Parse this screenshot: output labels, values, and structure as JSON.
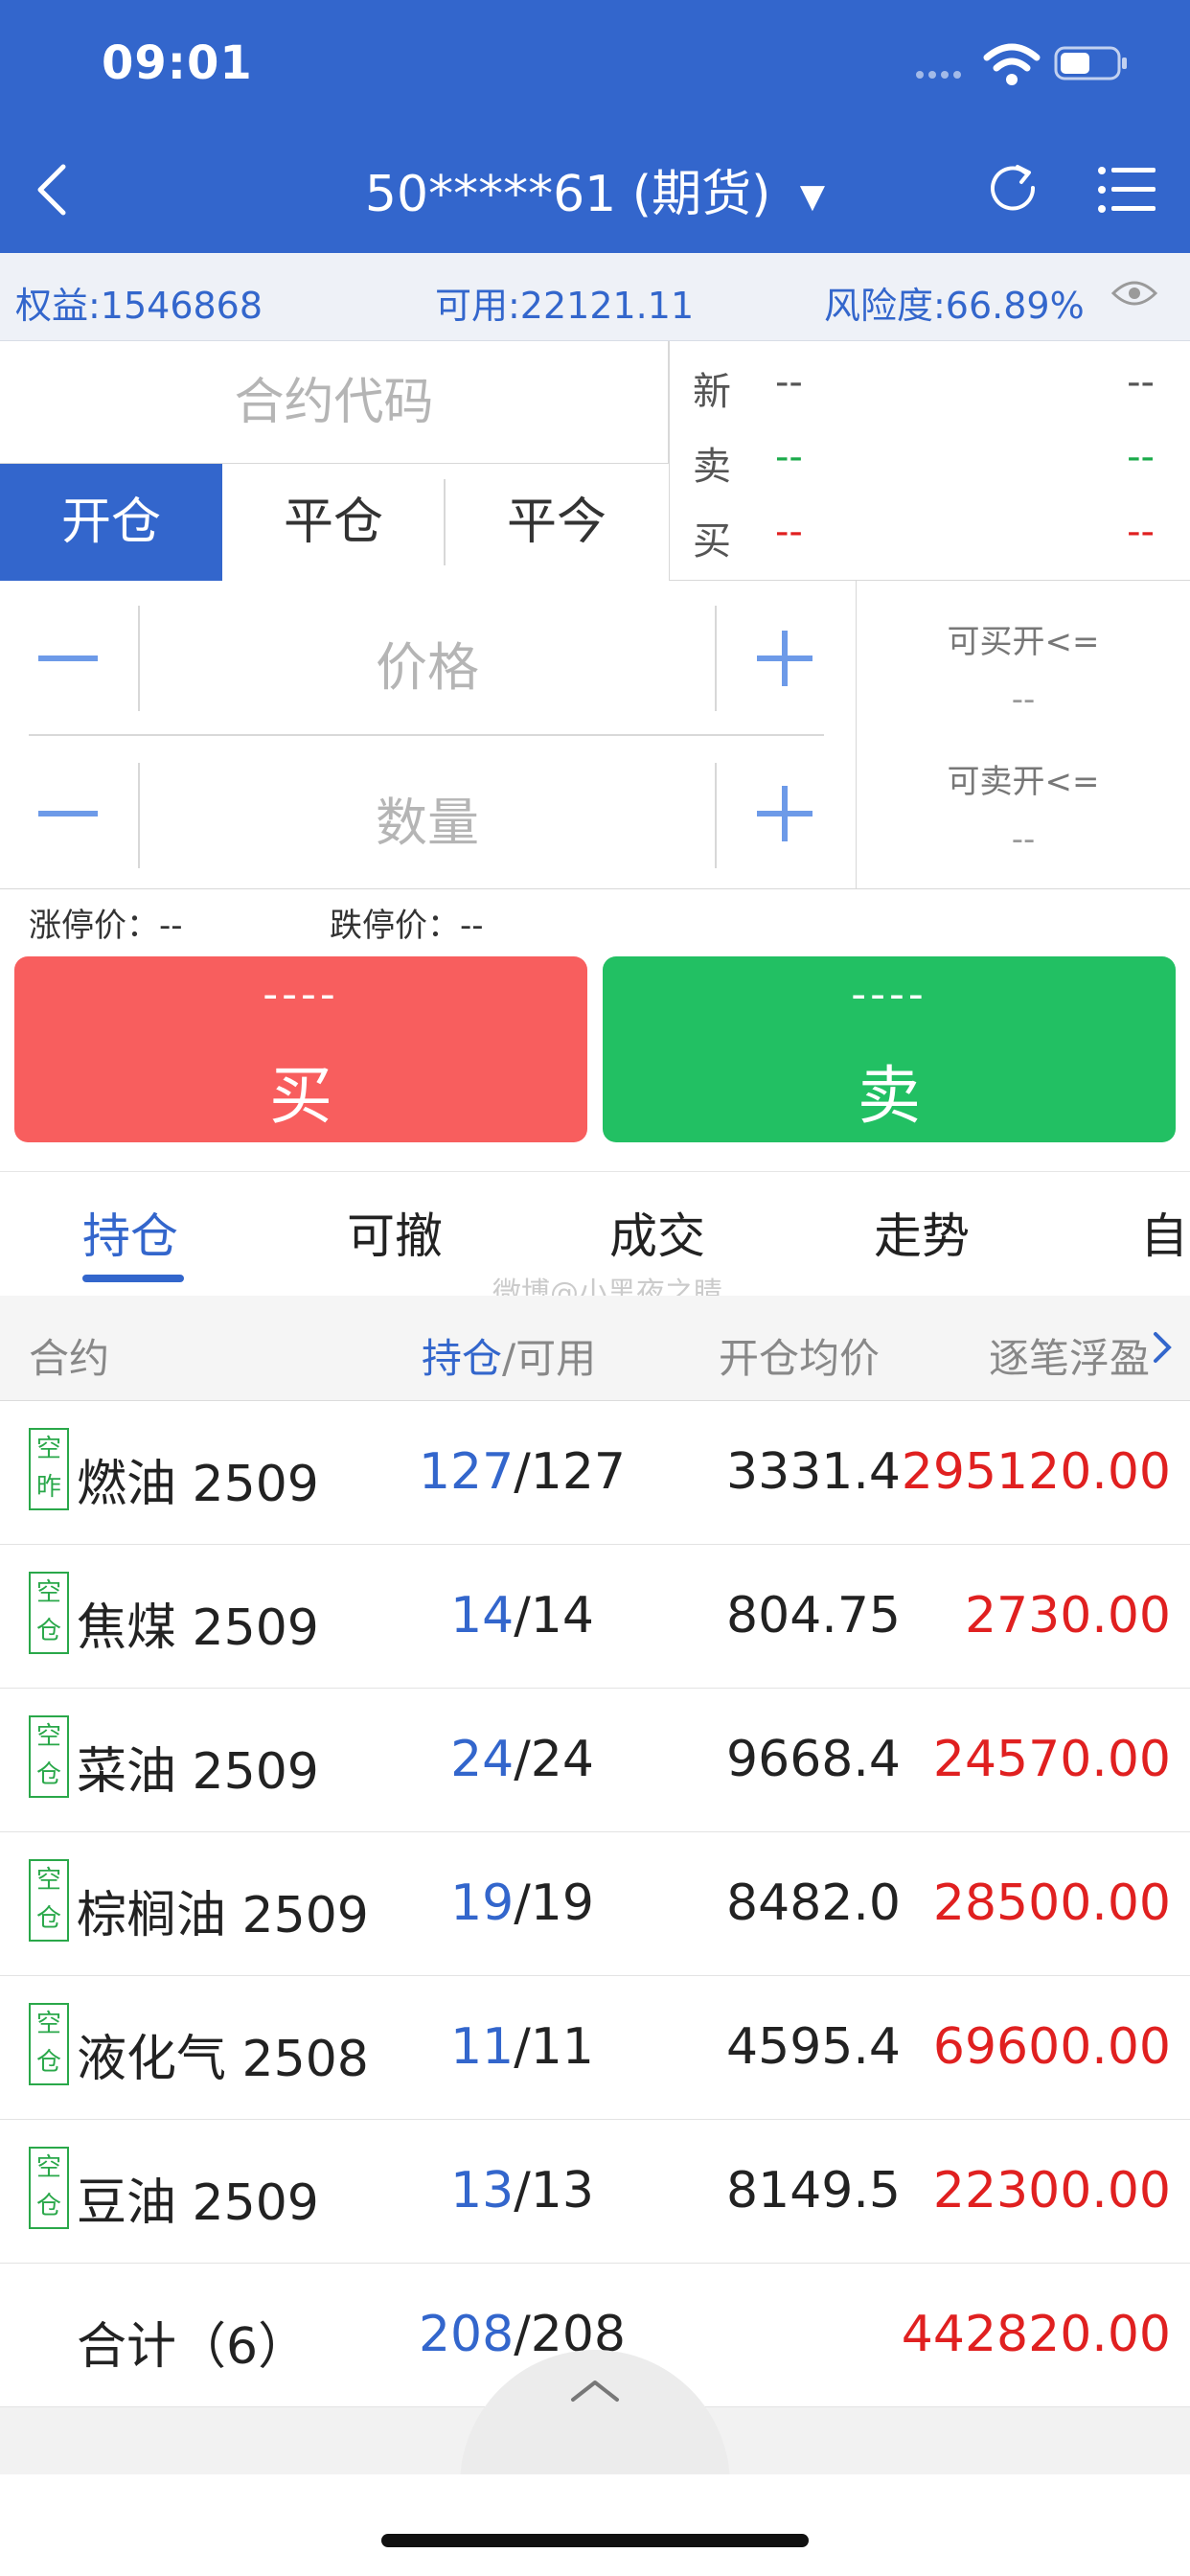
{
  "status_bar": {
    "time": "09:01"
  },
  "header": {
    "account": "50*****61",
    "account_type": "(期货)",
    "dropdown_icon": "caret-down-icon",
    "back_icon": "chevron-left-icon",
    "refresh_icon": "refresh-icon",
    "menu_icon": "list-menu-icon"
  },
  "account_info": {
    "equity": "权益:1546868",
    "available": "可用:22121.11",
    "risk": "风险度:66.89%",
    "eye_icon": "eye-icon"
  },
  "order": {
    "code_placeholder": "合约代码",
    "tabs": [
      "开仓",
      "平仓",
      "平今"
    ],
    "quote": [
      {
        "label": "新",
        "v1": "--",
        "v2": "--"
      },
      {
        "label": "卖",
        "v1": "--",
        "v2": "--"
      },
      {
        "label": "买",
        "v1": "--",
        "v2": "--"
      }
    ],
    "price_placeholder": "价格",
    "qty_placeholder": "数量",
    "can_buy_label": "可买开<=",
    "can_buy_value": "--",
    "can_sell_label": "可卖开<=",
    "can_sell_value": "--",
    "limit_up": "涨停价：--",
    "limit_down": "跌停价：--",
    "buy_price": "----",
    "buy_label": "买",
    "sell_price": "----",
    "sell_label": "卖"
  },
  "tabs": [
    "持仓",
    "可撤",
    "成交",
    "走势",
    "自"
  ],
  "watermark": "微博@小黑夜之睛",
  "table": {
    "headers": {
      "contract": "合约",
      "pos_a": "持仓",
      "pos_b": "/可用",
      "avg": "开仓均价",
      "pnl": "逐笔浮盈"
    },
    "rows": [
      {
        "badge1": "空",
        "badge2": "昨",
        "name": "燃油 2509",
        "pos": "127",
        "avail": "/127",
        "avg": "3331.4",
        "pnl": "295120.00"
      },
      {
        "badge1": "空",
        "badge2": "仓",
        "name": "焦煤 2509",
        "pos": "14",
        "avail": "/14",
        "avg": "804.75",
        "pnl": "2730.00"
      },
      {
        "badge1": "空",
        "badge2": "仓",
        "name": "菜油 2509",
        "pos": "24",
        "avail": "/24",
        "avg": "9668.4",
        "pnl": "24570.00"
      },
      {
        "badge1": "空",
        "badge2": "仓",
        "name": "棕榈油 2509",
        "pos": "19",
        "avail": "/19",
        "avg": "8482.0",
        "pnl": "28500.00"
      },
      {
        "badge1": "空",
        "badge2": "仓",
        "name": "液化气 2508",
        "pos": "11",
        "avail": "/11",
        "avg": "4595.4",
        "pnl": "69600.00"
      },
      {
        "badge1": "空",
        "badge2": "仓",
        "name": "豆油 2509",
        "pos": "13",
        "avail": "/13",
        "avg": "8149.5",
        "pnl": "22300.00"
      }
    ],
    "total": {
      "name": "合计（6）",
      "pos": "208",
      "avail": "/208",
      "pnl": "442820.00"
    }
  },
  "colors": {
    "brand": "#3366cc",
    "buy": "#f85e5e",
    "sell": "#22c063",
    "profit": "#e02020",
    "badge": "#2aa84a"
  }
}
